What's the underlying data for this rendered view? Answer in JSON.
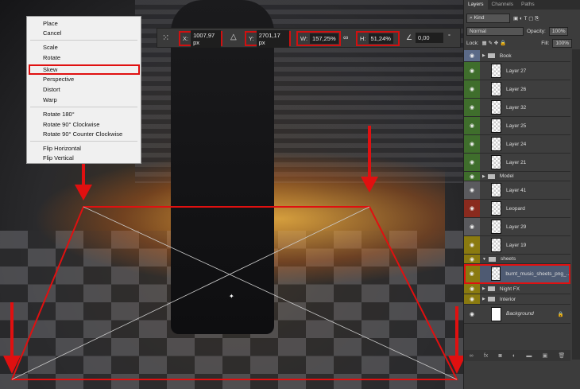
{
  "context_menu": {
    "items": [
      "Place",
      "Cancel",
      "Scale",
      "Rotate",
      "Skew",
      "Perspective",
      "Distort",
      "Warp",
      "Rotate 180°",
      "Rotate 90° Clockwise",
      "Rotate 90° Counter Clockwise",
      "Flip Horizontal",
      "Flip Vertical"
    ],
    "selected": "Skew"
  },
  "options_bar": {
    "x_label": "X:",
    "x_value": "1007,97 px",
    "y_label": "Y:",
    "y_value": "2701,17 px",
    "w_label": "W:",
    "w_value": "157,25%",
    "h_label": "H:",
    "h_value": "51,24%",
    "angle_value": "0,00",
    "degree": "°"
  },
  "panel": {
    "tabs": [
      "Layers",
      "Channels",
      "Paths"
    ],
    "kind_placeholder": "Kind",
    "blend_mode": "Normal",
    "opacity_label": "Opacity:",
    "opacity_value": "100%",
    "lock_label": "Lock:",
    "fill_label": "Fill:",
    "fill_value": "100%"
  },
  "layers": [
    {
      "name": "Book",
      "type": "group",
      "color": "#5b6a88"
    },
    {
      "name": "Layer 27",
      "type": "layer",
      "color": "#3f6e2c"
    },
    {
      "name": "Layer 26",
      "type": "layer",
      "color": "#3f6e2c"
    },
    {
      "name": "Layer 32",
      "type": "layer",
      "color": "#3f6e2c"
    },
    {
      "name": "Layer 25",
      "type": "layer",
      "color": "#3f6e2c"
    },
    {
      "name": "Layer 24",
      "type": "layer",
      "color": "#3f6e2c"
    },
    {
      "name": "Layer 21",
      "type": "layer",
      "color": "#3f6e2c"
    },
    {
      "name": "Model",
      "type": "group",
      "color": "#3f6e2c"
    },
    {
      "name": "Layer 41",
      "type": "layer",
      "color": "#5a5a5e"
    },
    {
      "name": "Leopard",
      "type": "smart",
      "color": "#8a2a1e"
    },
    {
      "name": "Layer 29",
      "type": "layer",
      "color": "#5a5a5e"
    },
    {
      "name": "Layer 19",
      "type": "layer",
      "color": "#8a7a10"
    },
    {
      "name": "sheets",
      "type": "group-open",
      "color": "#8a7a10"
    },
    {
      "name": "burnt_music_sheets_png_...",
      "type": "smart",
      "color": "#8a7a10",
      "selected": true
    },
    {
      "name": "Night FX",
      "type": "group",
      "color": "#8a7a10"
    },
    {
      "name": "Interior",
      "type": "group",
      "color": "#8a7a10"
    },
    {
      "name": "Background",
      "type": "background",
      "color": "#3e3e3e"
    }
  ],
  "accent": "#e01010"
}
